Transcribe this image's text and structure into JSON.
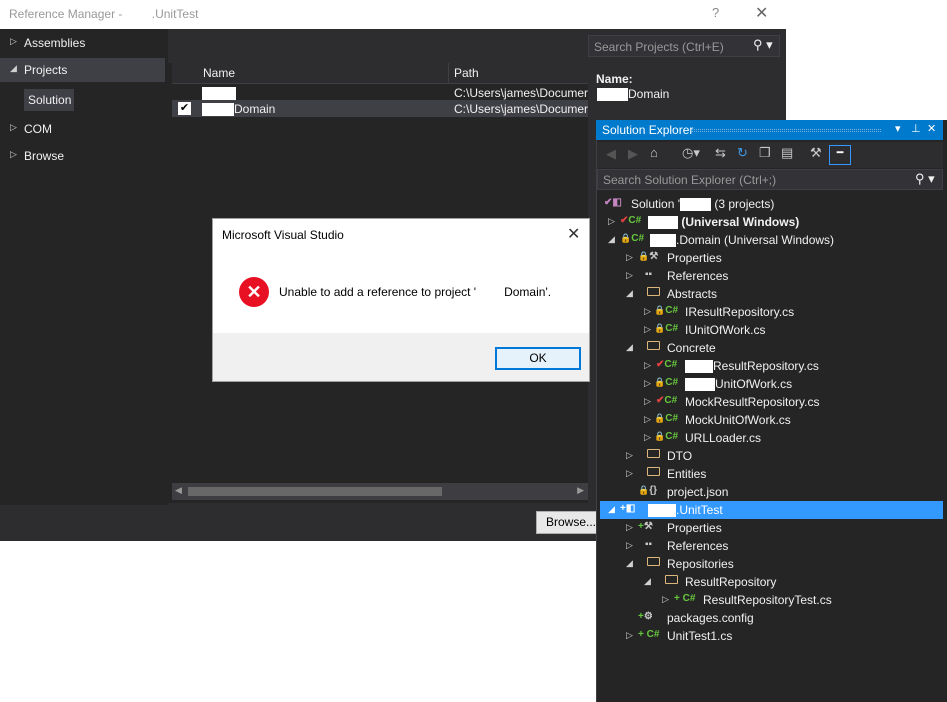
{
  "ref_manager": {
    "title_prefix": "Reference Manager -",
    "title_suffix": ".UnitTest",
    "help": "?",
    "close": "✕",
    "nav": [
      {
        "label": "Assemblies",
        "arrow": "▷"
      },
      {
        "label": "Projects",
        "arrow": "◢"
      },
      {
        "label": "COM",
        "arrow": "▷"
      },
      {
        "label": "Browse",
        "arrow": "▷"
      }
    ],
    "nav_sub_selected": "Solution",
    "columns": {
      "name": "Name",
      "path": "Path"
    },
    "rows": [
      {
        "name_suffix": "",
        "path": "C:\\Users\\james\\Documer",
        "checked": false
      },
      {
        "name_suffix": "Domain",
        "path": "C:\\Users\\james\\Documer",
        "checked": true
      }
    ],
    "search_placeholder": "Search Projects (Ctrl+E)",
    "detail_name_label": "Name:",
    "detail_name_value": "Domain",
    "browse_button": "Browse..."
  },
  "solution_explorer": {
    "title": "Solution Explorer",
    "search_placeholder": "Search Solution Explorer (Ctrl+;)",
    "tree": [
      {
        "text": "Solution '",
        "extra": "(3 projects)"
      },
      {
        "text": "(Universal Windows)"
      },
      {
        "text": ".Domain (Universal Windows)"
      },
      {
        "text": "Properties"
      },
      {
        "text": "References"
      },
      {
        "text": "Abstracts"
      },
      {
        "text": "IResultRepository.cs"
      },
      {
        "text": "IUnitOfWork.cs"
      },
      {
        "text": "Concrete"
      },
      {
        "text": "ResultRepository.cs"
      },
      {
        "text": "UnitOfWork.cs"
      },
      {
        "text": "MockResultRepository.cs"
      },
      {
        "text": "MockUnitOfWork.cs"
      },
      {
        "text": "URLLoader.cs"
      },
      {
        "text": "DTO"
      },
      {
        "text": "Entities"
      },
      {
        "text": "project.json"
      },
      {
        "text": ".UnitTest"
      },
      {
        "text": "Properties"
      },
      {
        "text": "References"
      },
      {
        "text": "Repositories"
      },
      {
        "text": "ResultRepository"
      },
      {
        "text": "ResultRepositoryTest.cs"
      },
      {
        "text": "packages.config"
      },
      {
        "text": "UnitTest1.cs"
      }
    ]
  },
  "dialog": {
    "title": "Microsoft Visual Studio",
    "message_prefix": "Unable to add a reference to project '",
    "message_suffix": "Domain'.",
    "ok": "OK",
    "close": "✕"
  },
  "colors": {
    "vs_dark": "#2d2d30",
    "vs_blue": "#007acc",
    "selection": "#3399ff",
    "error_red": "#e81123"
  }
}
